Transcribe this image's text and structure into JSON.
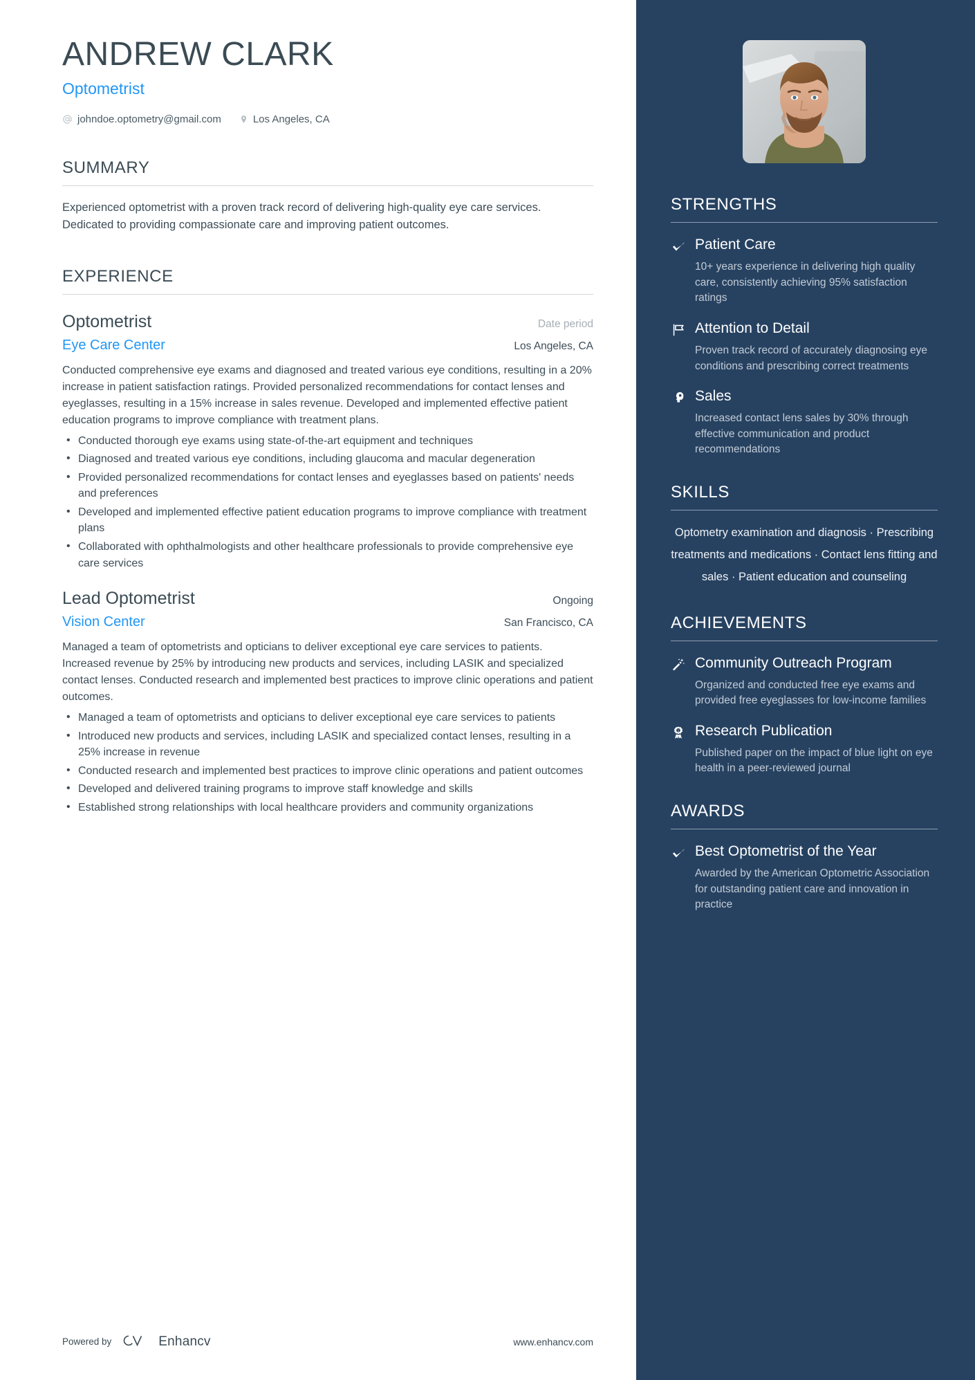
{
  "header": {
    "name": "ANDREW CLARK",
    "title": "Optometrist",
    "email": "johndoe.optometry@gmail.com",
    "location": "Los Angeles, CA"
  },
  "summary": {
    "heading": "SUMMARY",
    "text": "Experienced optometrist with a proven track record of delivering high-quality eye care services. Dedicated to providing compassionate care and improving patient outcomes."
  },
  "experience": {
    "heading": "EXPERIENCE",
    "jobs": [
      {
        "role": "Optometrist",
        "date": "Date period",
        "date_is_placeholder": true,
        "company": "Eye Care Center",
        "location": "Los Angeles, CA",
        "description": "Conducted comprehensive eye exams and diagnosed and treated various eye conditions, resulting in a 20% increase in patient satisfaction ratings. Provided personalized recommendations for contact lenses and eyeglasses, resulting in a 15% increase in sales revenue. Developed and implemented effective patient education programs to improve compliance with treatment plans.",
        "bullets": [
          "Conducted thorough eye exams using state-of-the-art equipment and techniques",
          "Diagnosed and treated various eye conditions, including glaucoma and macular degeneration",
          "Provided personalized recommendations for contact lenses and eyeglasses based on patients' needs and preferences",
          "Developed and implemented effective patient education programs to improve compliance with treatment plans",
          "Collaborated with ophthalmologists and other healthcare professionals to provide comprehensive eye care services"
        ]
      },
      {
        "role": "Lead Optometrist",
        "date": "Ongoing",
        "date_is_placeholder": false,
        "company": "Vision Center",
        "location": "San Francisco, CA",
        "description": "Managed a team of optometrists and opticians to deliver exceptional eye care services to patients. Increased revenue by 25% by introducing new products and services, including LASIK and specialized contact lenses. Conducted research and implemented best practices to improve clinic operations and patient outcomes.",
        "bullets": [
          "Managed a team of optometrists and opticians to deliver exceptional eye care services to patients",
          "Introduced new products and services, including LASIK and specialized contact lenses, resulting in a 25% increase in revenue",
          "Conducted research and implemented best practices to improve clinic operations and patient outcomes",
          "Developed and delivered training programs to improve staff knowledge and skills",
          "Established strong relationships with local healthcare providers and community organizations"
        ]
      }
    ]
  },
  "strengths": {
    "heading": "STRENGTHS",
    "items": [
      {
        "icon": "check-icon",
        "label": "Patient Care",
        "description": "10+ years experience in delivering high quality care, consistently achieving 95% satisfaction ratings"
      },
      {
        "icon": "flag-icon",
        "label": "Attention to Detail",
        "description": "Proven track record of accurately diagnosing eye conditions and prescribing correct treatments"
      },
      {
        "icon": "head-profile-icon",
        "label": "Sales",
        "description": "Increased contact lens sales by 30% through effective communication and product recommendations"
      }
    ]
  },
  "skills": {
    "heading": "SKILLS",
    "separator": "·",
    "items": [
      "Optometry examination and diagnosis",
      "Prescribing treatments and medications",
      "Contact lens fitting and sales",
      "Patient education and counseling"
    ]
  },
  "achievements": {
    "heading": "ACHIEVEMENTS",
    "items": [
      {
        "icon": "magic-wand-icon",
        "label": "Community Outreach Program",
        "description": "Organized and conducted free eye exams and provided free eyeglasses for low-income families"
      },
      {
        "icon": "award-ribbon-icon",
        "label": "Research Publication",
        "description": "Published paper on the impact of blue light on eye health in a peer-reviewed journal"
      }
    ]
  },
  "awards": {
    "heading": "AWARDS",
    "items": [
      {
        "icon": "check-icon",
        "label": "Best Optometrist of the Year",
        "description": "Awarded by the American Optometric Association for outstanding patient care and innovation in practice"
      }
    ]
  },
  "footer": {
    "powered_by": "Powered by",
    "brand": "Enhancv",
    "website": "www.enhancv.com"
  },
  "colors": {
    "sidebar_bg": "#274261",
    "accent_blue": "#2196f3",
    "heading_dark": "#3b4b54",
    "body_text": "#3d4d57",
    "muted": "#a6aeb4"
  }
}
